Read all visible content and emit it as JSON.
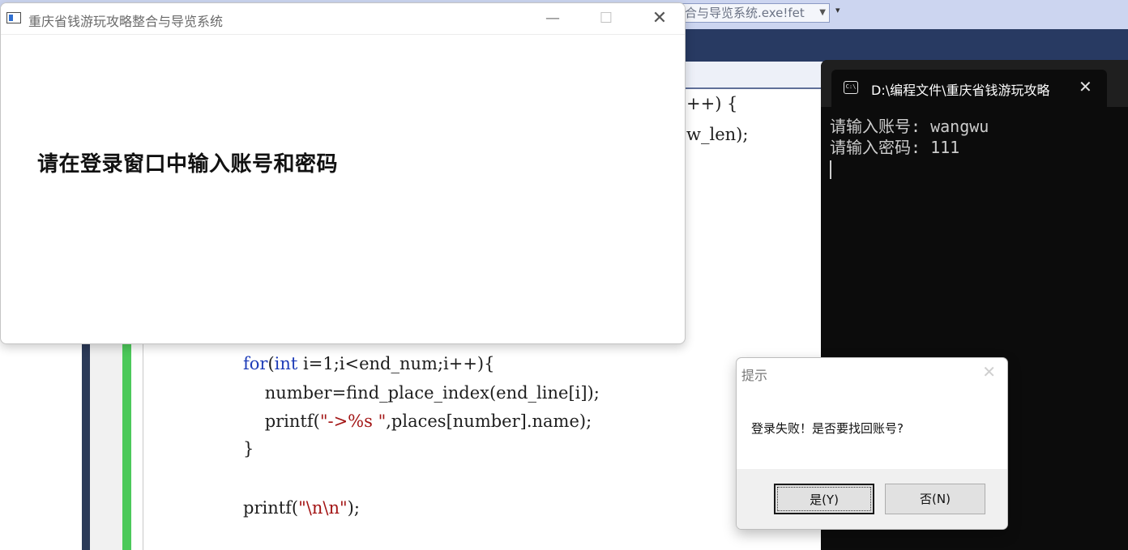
{
  "ide": {
    "build_combo": "合与导览系统.exe!fet",
    "code_fragments": [
      "++) {",
      "w_len);"
    ],
    "code": {
      "for_keyword": "for",
      "for_paren_open": "(",
      "int_keyword": "int",
      "for_rest": " i=1;i<end_num;i++){",
      "line2": "    number=find_place_index(end_line[i]);",
      "line3_a": "    printf(",
      "line3_str": "\"->%s \"",
      "line3_b": ",places[number].name);",
      "line4": "}",
      "line5_a": "printf(",
      "line5_str": "\"\\n\\n\"",
      "line5_b": ");"
    }
  },
  "app_window": {
    "title": "重庆省钱游玩攻略整合与导览系统",
    "minimize_glyph": "—",
    "maximize_glyph": "☐",
    "close_glyph": "✕",
    "prompt": "请在登录窗口中输入账号和密码"
  },
  "console": {
    "tab_title": "D:\\编程文件\\重庆省钱游玩攻略",
    "tab_icon_text": "C:\\",
    "close_glyph": "✕",
    "lines": [
      "请输入账号: wangwu",
      "请输入密码: 111"
    ]
  },
  "msgbox": {
    "title": "提示",
    "close_glyph": "✕",
    "message": "登录失败！是否要找回账号?",
    "yes_label": "是(Y)",
    "no_label": "否(N)"
  },
  "colors": {
    "console_bg": "#0c0c0c",
    "ide_toolbar": "#283a62",
    "change_bar": "#4cc95a",
    "keyword": "#1f3db8",
    "string": "#a31515"
  }
}
